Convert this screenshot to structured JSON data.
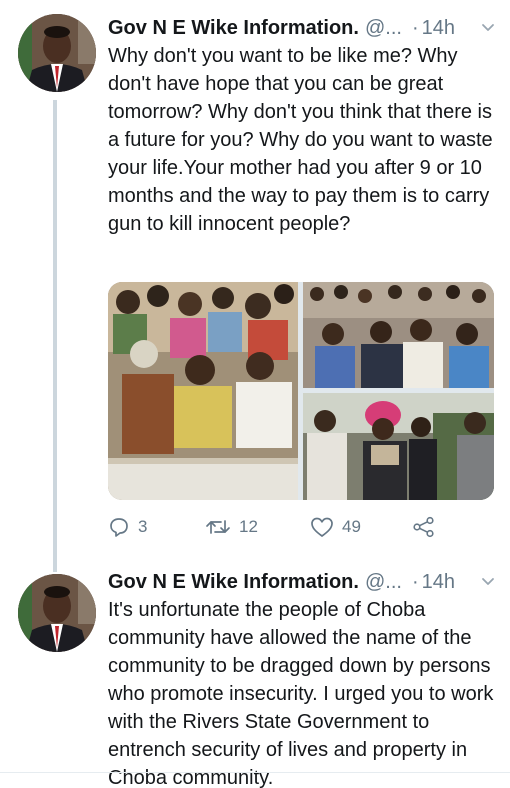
{
  "tweets": [
    {
      "author_name": "Gov N E Wike Information.",
      "handle": "@...",
      "separator": "·",
      "time": "14h",
      "text": "Why don't you want to be like me? Why don't have hope that you can be great tomorrow? Why don't you think that there is a future for you? Why do you want to waste your life.Your mother had you after 9 or 10 months and the way to pay them is to carry gun to kill innocent people?",
      "replies": "3",
      "retweets": "12",
      "likes": "49"
    },
    {
      "author_name": "Gov N E Wike Information.",
      "handle": "@...",
      "separator": "·",
      "time": "14h",
      "text": "It's unfortunate the people of Choba community have allowed the name of the community to be dragged down by persons who promote insecurity.  I urged you to work with the Rivers State Government to entrench security of lives and property in Choba community."
    }
  ],
  "colors": {
    "text": "#14171a",
    "secondary": "#657786",
    "thread_line": "#ccd6dd",
    "divider": "#e6ecf0"
  },
  "icons": {
    "reply": "speech-bubble-icon",
    "retweet": "retweet-arrows-icon",
    "like": "heart-outline-icon",
    "share": "share-nodes-icon",
    "menu": "chevron-down-icon"
  }
}
